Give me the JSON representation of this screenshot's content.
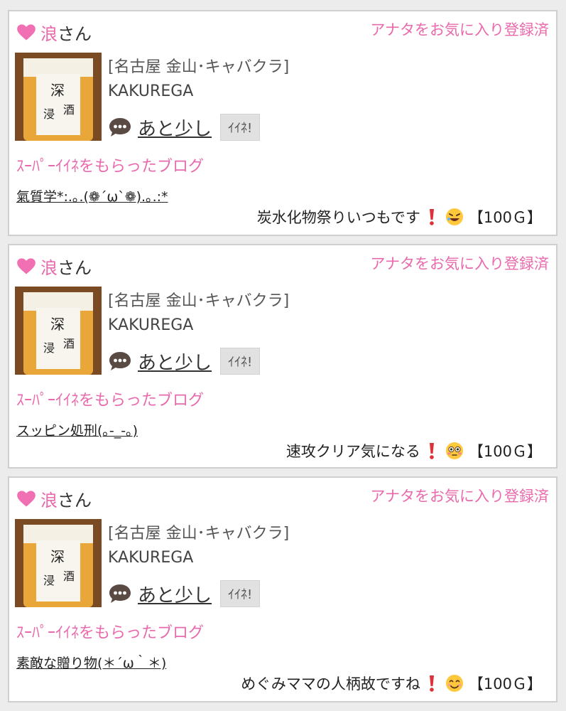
{
  "posts": [
    {
      "user_name": "浪",
      "san": "さん",
      "fav_status": "アナタをお気に入り登録済",
      "location": "[名古屋 金山･キャバクラ]",
      "shop": "KAKUREGA",
      "status": "あと少し",
      "iine_label": "ｲｲﾈ!",
      "super_label": "ｽｰﾊﾟｰｲｲﾈをもらったブログ",
      "blog_title": "氣質学*:.｡.(❁´ω`❁).｡.:*",
      "comment": "炭水化物祭りいつもです",
      "emoji_name": "rofl-emoji",
      "points": "【100Ｇ】"
    },
    {
      "user_name": "浪",
      "san": "さん",
      "fav_status": "アナタをお気に入り登録済",
      "location": "[名古屋 金山･キャバクラ]",
      "shop": "KAKUREGA",
      "status": "あと少し",
      "iine_label": "ｲｲﾈ!",
      "super_label": "ｽｰﾊﾟｰｲｲﾈをもらったブログ",
      "blog_title": "スッピン処刑(｡-_-｡)",
      "comment": "速攻クリア気になる",
      "emoji_name": "flushed-emoji",
      "points": "【100Ｇ】"
    },
    {
      "user_name": "浪",
      "san": "さん",
      "fav_status": "アナタをお気に入り登録済",
      "location": "[名古屋 金山･キャバクラ]",
      "shop": "KAKUREGA",
      "status": "あと少し",
      "iine_label": "ｲｲﾈ!",
      "super_label": "ｽｰﾊﾟｰｲｲﾈをもらったブログ",
      "blog_title": "素敵な贈り物(＊´ω｀＊)",
      "comment": "めぐみママの人柄故ですね",
      "emoji_name": "smile-emoji",
      "points": "【100Ｇ】"
    }
  ],
  "colors": {
    "accent": "#e96aac",
    "iine_bg": "#e1e1e1",
    "page_bg": "#ececec"
  }
}
